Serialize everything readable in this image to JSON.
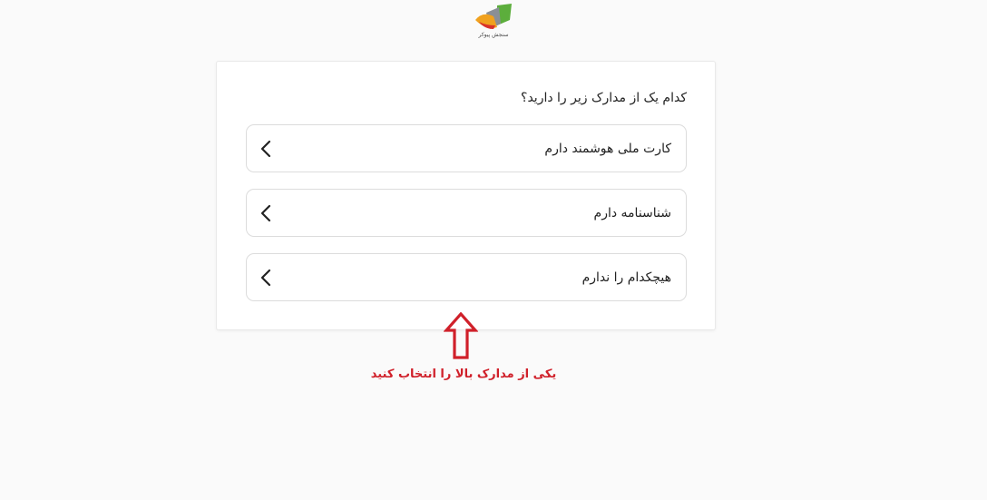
{
  "logo": {
    "caption": "سنجش پیوکر",
    "icon": "logo-icon",
    "colors": {
      "green": "#5cae3c",
      "orange": "#f0a11e",
      "red": "#d9322a",
      "gray": "#8a8f96"
    }
  },
  "form": {
    "question": "کدام یک از مدارک زیر را دارید؟",
    "options": [
      {
        "label": "کارت ملی هوشمند دارم",
        "icon": "chevron-left-icon"
      },
      {
        "label": "شناسنامه دارم",
        "icon": "chevron-left-icon"
      },
      {
        "label": "هیچکدام را ندارم",
        "icon": "chevron-left-icon"
      }
    ]
  },
  "annotation": {
    "icon": "up-arrow-icon",
    "text": "یکی از مدارک بالا را انتخاب کنید",
    "color": "#d0202a"
  }
}
